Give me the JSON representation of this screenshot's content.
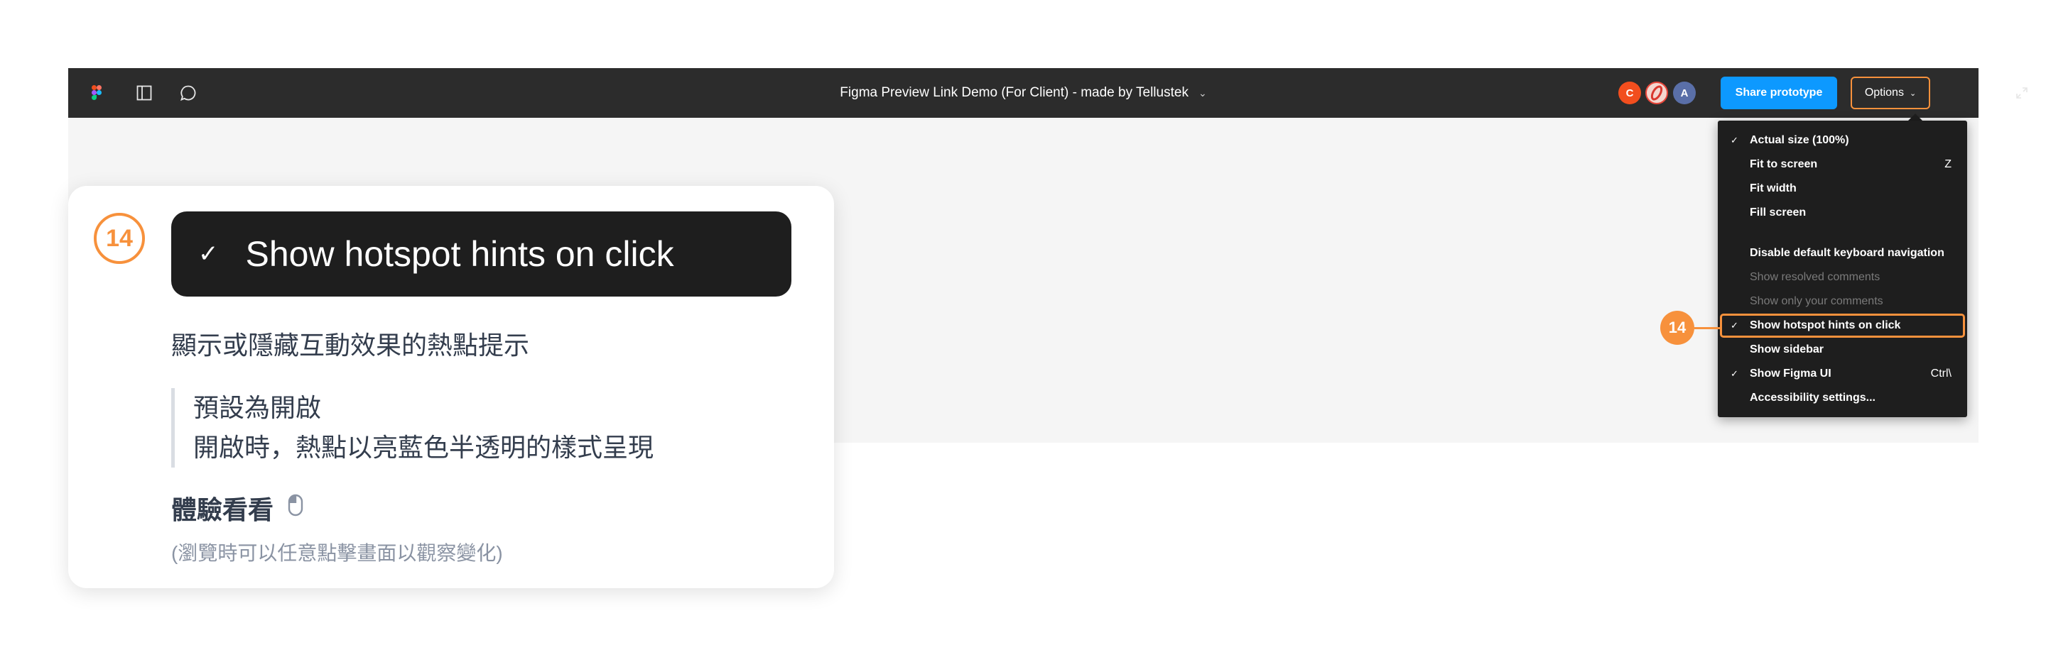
{
  "topbar": {
    "title": "Figma Preview Link Demo (For Client) - made by Tellustek",
    "title_caret": "⌄",
    "avatars": [
      "C",
      "A"
    ],
    "share_label": "Share prototype",
    "options_label": "Options",
    "options_chevron": "⌄"
  },
  "menu": {
    "items": [
      {
        "label": "Actual size (100%)",
        "checked": true,
        "enabled": true,
        "shortcut": ""
      },
      {
        "label": "Fit to screen",
        "checked": false,
        "enabled": true,
        "shortcut": "Z"
      },
      {
        "label": "Fit width",
        "checked": false,
        "enabled": true,
        "shortcut": ""
      },
      {
        "label": "Fill screen",
        "checked": false,
        "enabled": true,
        "shortcut": ""
      },
      {
        "label": "Disable default keyboard navigation",
        "checked": false,
        "enabled": true,
        "shortcut": ""
      },
      {
        "label": "Show resolved comments",
        "checked": false,
        "enabled": false,
        "shortcut": ""
      },
      {
        "label": "Show only your comments",
        "checked": false,
        "enabled": false,
        "shortcut": ""
      },
      {
        "label": "Show hotspot hints on click",
        "checked": true,
        "enabled": true,
        "shortcut": ""
      },
      {
        "label": "Show sidebar",
        "checked": false,
        "enabled": true,
        "shortcut": ""
      },
      {
        "label": "Show Figma UI",
        "checked": true,
        "enabled": true,
        "shortcut": "Ctrl\\"
      },
      {
        "label": "Accessibility settings...",
        "checked": false,
        "enabled": true,
        "shortcut": ""
      }
    ],
    "check_glyph": "✓"
  },
  "callout": {
    "number": "14"
  },
  "card": {
    "number": "14",
    "chip_check": "✓",
    "chip_label": "Show hotspot hints on click",
    "description": "顯示或隱藏互動效果的熱點提示",
    "quote_line1": "預設為開啟",
    "quote_line2": "開啟時，熱點以亮藍色半透明的樣式呈現",
    "try_label": "體驗看看",
    "hint": "(瀏覽時可以任意點擊畫面以觀察變化)"
  },
  "colors": {
    "accent_orange": "#f7913c",
    "share_blue": "#0d99ff",
    "bar_dark": "#2c2c2c",
    "menu_dark": "#1e1e1e"
  },
  "icons": [
    "figma-logo",
    "sidebar-panel-icon",
    "comment-icon",
    "expand-icon",
    "mouse-icon",
    "checkmark-icon"
  ]
}
